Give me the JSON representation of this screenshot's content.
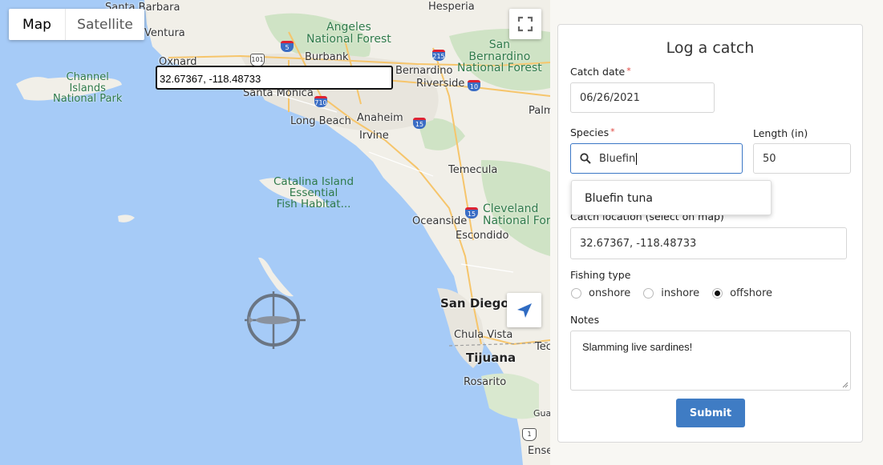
{
  "map": {
    "type_control": {
      "map_label": "Map",
      "satellite_label": "Satellite"
    },
    "coordinate_popup": "32.67367, -118.48733",
    "places": {
      "santa_barbara": "Santa Barbara",
      "hesperia": "Hesperia",
      "ventura": "Ventura",
      "oxnard": "Oxnard",
      "angeles_nf": "Angeles\nNational Forest",
      "burbank": "Burbank",
      "san_bernardino_nf": "San\nBernardino\nNational Forest",
      "bernardino": "Bernardino",
      "riverside": "Riverside",
      "channel_islands": "Channel\nIslands\nNational Park",
      "santa_monica": "Santa Monica",
      "long_beach": "Long Beach",
      "anaheim": "Anaheim",
      "irvine": "Irvine",
      "palm": "Palm",
      "temecula": "Temecula",
      "catalina": "Catalina Island\nEssential\nFish Habitat...",
      "cleveland": "Cleveland\nNational Fore",
      "oceanside": "Oceanside",
      "escondido": "Escondido",
      "san_diego": "San Diego",
      "chula_vista": "Chula Vista",
      "tecate": "Tec",
      "tijuana": "Tijuana",
      "rosarito": "Rosarito",
      "gua": "Gua",
      "ense": "Ense"
    },
    "shields": {
      "s101": "101",
      "s5": "5",
      "s215": "215",
      "s10": "10",
      "s710": "710",
      "s15": "15",
      "s15b": "15",
      "s1": "1"
    }
  },
  "form": {
    "title": "Log a catch",
    "catch_date_label": "Catch date",
    "catch_date_value": "06/26/2021",
    "species_label": "Species",
    "species_value": "Bluefin",
    "length_label": "Length (in)",
    "length_value": "50",
    "suggestion": "Bluefin tuna",
    "location_label": "Catch location (select on map)",
    "location_value": "32.67367, -118.48733",
    "fishing_type_label": "Fishing type",
    "fishing_types": [
      "onshore",
      "inshore",
      "offshore"
    ],
    "fishing_type_selected": "offshore",
    "notes_label": "Notes",
    "notes_value": "Slamming live sardines!",
    "submit_label": "Submit",
    "required_mark": "*"
  }
}
